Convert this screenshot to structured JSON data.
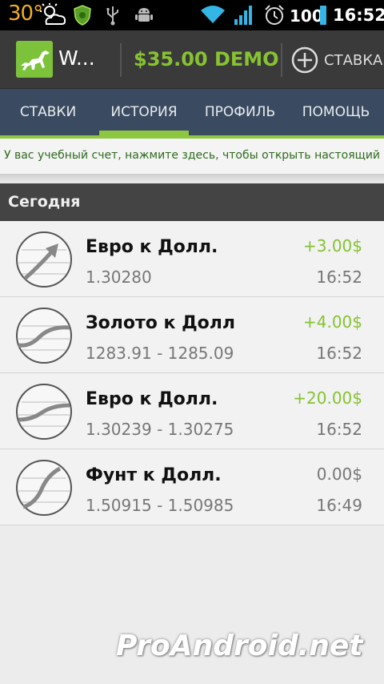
{
  "status_bar": {
    "temperature": "30°",
    "battery_level": "100",
    "time": "16:52",
    "icons": [
      "weather-icon",
      "shield-icon",
      "usb-icon",
      "android-debug-icon",
      "wifi-icon",
      "signal-icon",
      "alarm-icon",
      "battery-icon"
    ]
  },
  "action_bar": {
    "app_title": "W...",
    "balance": "$35.00 DEMO",
    "add_bet_label": "СТАВКА",
    "colors": {
      "balance": "#86c232",
      "background": "#3a3a3a"
    }
  },
  "tabs": [
    {
      "label": "СТАВКИ",
      "active": false
    },
    {
      "label": "ИСТОРИЯ",
      "active": true
    },
    {
      "label": "ПРОФИЛЬ",
      "active": false
    },
    {
      "label": "ПОМОЩЬ",
      "active": false
    }
  ],
  "banner": {
    "text": "У вас учебный счет, нажмите здесь, чтобы открыть настоящий"
  },
  "section": {
    "title": "Сегодня"
  },
  "history": [
    {
      "name": "Евро к Долл.",
      "rate": "1.30280",
      "profit": "+3.00$",
      "time": "16:52",
      "icon": "trend-up-icon"
    },
    {
      "name": "Золото к Долл",
      "rate": "1283.91 - 1285.09",
      "profit": "+4.00$",
      "time": "16:52",
      "icon": "range-wave-icon"
    },
    {
      "name": "Евро к Долл.",
      "rate": "1.30239 - 1.30275",
      "profit": "+20.00$",
      "time": "16:52",
      "icon": "range-wave-icon"
    },
    {
      "name": "Фунт к Долл.",
      "rate": "1.50915 - 1.50985",
      "profit": "0.00$",
      "time": "16:49",
      "icon": "range-wave-icon"
    }
  ],
  "watermark": "ProAndroid.net"
}
